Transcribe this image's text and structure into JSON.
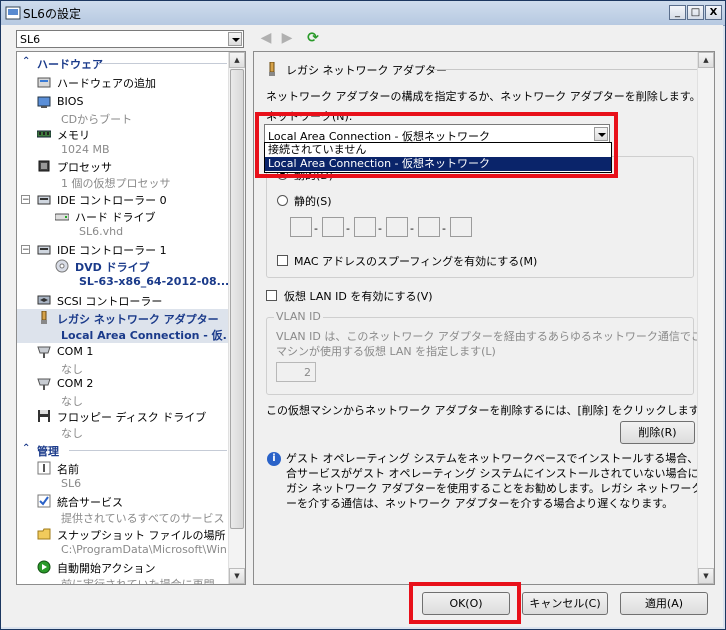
{
  "window": {
    "title": "SL6の設定",
    "minimize": "_",
    "maximize": "□",
    "close": "X"
  },
  "vm_selector": {
    "value": "SL6"
  },
  "tree": {
    "hardware_header": "ハードウェア",
    "manage_header": "管理",
    "items": [
      {
        "label": "ハードウェアの追加",
        "sub": ""
      },
      {
        "label": "BIOS",
        "sub": "CDからブート"
      },
      {
        "label": "メモリ",
        "sub": "1024 MB"
      },
      {
        "label": "プロセッサ",
        "sub": "1 個の仮想プロセッサ"
      },
      {
        "label": "IDE コントローラー 0",
        "sub": ""
      },
      {
        "label": "ハード ドライブ",
        "sub": "SL6.vhd"
      },
      {
        "label": "IDE コントローラー 1",
        "sub": ""
      },
      {
        "label": "DVD ドライブ",
        "sub": "SL-63-x86_64-2012-08..."
      },
      {
        "label": "SCSI コントローラー",
        "sub": ""
      },
      {
        "label": "レガシ ネットワーク アダプター",
        "sub": "Local Area Connection - 仮..."
      },
      {
        "label": "COM 1",
        "sub": "なし"
      },
      {
        "label": "COM 2",
        "sub": "なし"
      },
      {
        "label": "フロッピー ディスク ドライブ",
        "sub": "なし"
      },
      {
        "label": "名前",
        "sub": "SL6"
      },
      {
        "label": "統合サービス",
        "sub": "提供されているすべてのサービス"
      },
      {
        "label": "スナップショット ファイルの場所",
        "sub": "C:\\ProgramData\\Microsoft\\Win..."
      },
      {
        "label": "自動開始アクション",
        "sub": "前に実行されていた場合に再開..."
      }
    ]
  },
  "panel": {
    "title": "レガシ ネットワーク アダプター",
    "description": "ネットワーク アダプターの構成を指定するか、ネットワーク アダプターを削除します。",
    "network_label": "ネットワーク(N):",
    "network_value": "Local Area Connection - 仮想ネットワーク",
    "dropdown_options": [
      "接続されていません",
      "Local Area Connection - 仮想ネットワーク"
    ],
    "mac_dynamic": "動的(D)",
    "mac_static": "静的(S)",
    "mac_spoofing": "MAC アドレスのスプーフィングを有効にする(M)",
    "vlan_enable": "仮想 LAN ID を有効にする(V)",
    "vlan_group_label": "VLAN ID",
    "vlan_desc_1": "VLAN ID は、このネットワーク アダプターを経由するあらゆるネットワーク通信でこの仮想",
    "vlan_desc_2": "マシンが使用する仮想 LAN を指定します(L)",
    "vlan_value": "2",
    "remove_desc": "この仮想マシンからネットワーク アダプターを削除するには、[削除] をクリックします。",
    "remove_button": "削除(R)",
    "info_lines": [
      "ゲスト オペレーティング システムをネットワークベースでインストールする場合、または統",
      "合サービスがゲスト オペレーティング システムにインストールされていない場合にのみ、レ",
      "ガシ ネットワーク アダプターを使用することをお勧めします。レガシ ネットワーク アダプタ",
      "ーを介する通信は、ネットワーク アダプターを介する場合より遅くなります。"
    ]
  },
  "buttons": {
    "ok": "OK(O)",
    "cancel": "キャンセル(C)",
    "apply": "適用(A)"
  },
  "colors": {
    "highlight_box": "#e8101a",
    "selection": "#0a246a"
  }
}
